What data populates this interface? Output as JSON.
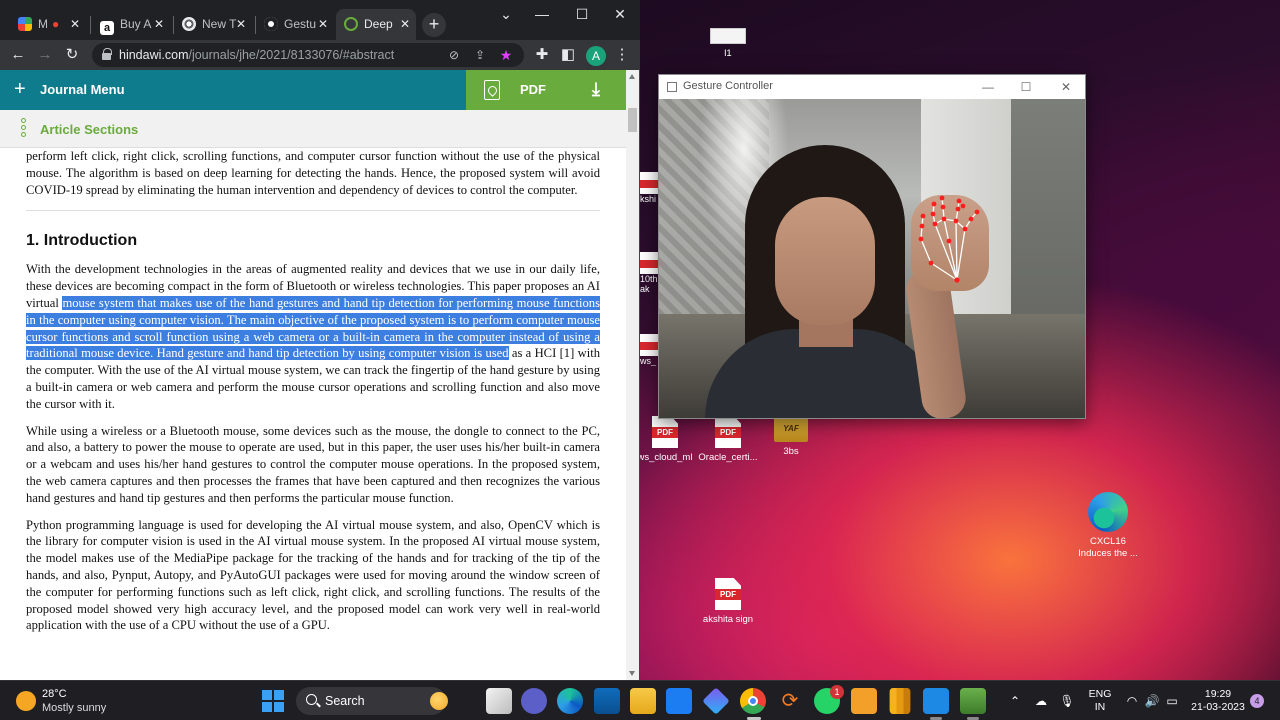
{
  "browser": {
    "tabs": [
      {
        "label": "M",
        "favicon": "meet-icon",
        "color": "#34a853"
      },
      {
        "label": "Buy A",
        "favicon": "amazon-icon",
        "color": "#ffffff"
      },
      {
        "label": "New T",
        "favicon": "chrome-icon",
        "color": "#e8eaed"
      },
      {
        "label": "Gestu",
        "favicon": "github-icon",
        "color": "#ffffff"
      },
      {
        "label": "Deep",
        "favicon": "hindawi-icon",
        "color": "#6aab3e"
      }
    ],
    "url_host": "hindawi.com",
    "url_path": "/journals/jhe/2021/8133076/#abstract",
    "profile_initial": "A"
  },
  "page": {
    "journal_menu": "Journal Menu",
    "pdf_label": "PDF",
    "article_sections": "Article Sections",
    "abstract_tail": "perform left click, right click, scrolling functions, and computer cursor function without the use of the physical mouse. The algorithm is based on deep learning for detecting the hands. Hence, the proposed system will avoid COVID-19 spread by eliminating the human intervention and dependency of devices to control the computer.",
    "heading": "1. Introduction",
    "p1_before": "With the development technologies in the areas of augmented reality and devices that we use in our daily life, these devices are becoming compact in the form of Bluetooth or wireless technologies. This paper proposes an AI virtual ",
    "p1_highlight": "mouse system that makes use of the hand gestures and hand tip detection for performing mouse functions in the computer using computer vision. The main objective of the proposed system is to perform computer mouse cursor functions and scroll function using a web camera or a built-in camera in the computer instead of using a traditional mouse device. Hand gesture and hand tip detection by using computer vision is used",
    "p1_after": " as a HCI [1] with the computer. With the use of the AI virtual mouse system, we can track the fingertip of the hand gesture by using a built-in camera or web camera and perform the mouse cursor operations and scrolling function and also move the cursor with it.",
    "p2": "While using a wireless or a Bluetooth mouse, some devices such as the mouse, the dongle to connect to the PC, and also, a battery to power the mouse to operate are used, but in this paper, the user uses his/her built-in camera or a webcam and uses his/her hand gestures to control the computer mouse operations. In the proposed system, the web camera captures and then processes the frames that have been captured and then recognizes the various hand gestures and hand tip gestures and then performs the particular mouse function.",
    "p3": "Python programming language is used for developing the AI virtual mouse system, and also, OpenCV which is the library for computer vision is used in the AI virtual mouse system. In the proposed AI virtual mouse system, the model makes use of the MediaPipe package for the tracking of the hands and for tracking of the tip of the hands, and also, Pynput, Autopy, and PyAutoGUI packages were used for moving around the window screen of the computer for performing functions such as left click, right click, and scrolling functions. The results of the proposed model showed very high accuracy level, and the proposed model can work very well in real-world application with the use of a CPU without the use of a GPU."
  },
  "gesture_window": {
    "title": "Gesture Controller"
  },
  "desktop_icons": {
    "top_label": "l1",
    "pdf1_label": "ws_cloud_ml",
    "pdf2_label": "Oracle_certi...",
    "zip_label": "3bs",
    "edge_label_1": "CXCL16",
    "edge_label_2": "Induces the ...",
    "pdf3_label": "akshita sign",
    "pdf_text": "PDF",
    "zip_text": "YAF",
    "partial_1": "kshi",
    "partial_2": "10th",
    "partial_2b": "ak",
    "partial_3": "ws_"
  },
  "taskbar": {
    "temperature": "28°C",
    "condition": "Mostly sunny",
    "search_label": "Search",
    "whatsapp_badge": "1",
    "lang_1": "ENG",
    "lang_2": "IN",
    "time": "19:29",
    "date": "21-03-2023",
    "notifications": "4"
  },
  "colors": {
    "journal_bar": "#0f7c8e",
    "pdf_bar": "#6aab3e",
    "selection": "#3d7fe0",
    "landmark": "#ff1e1e"
  }
}
